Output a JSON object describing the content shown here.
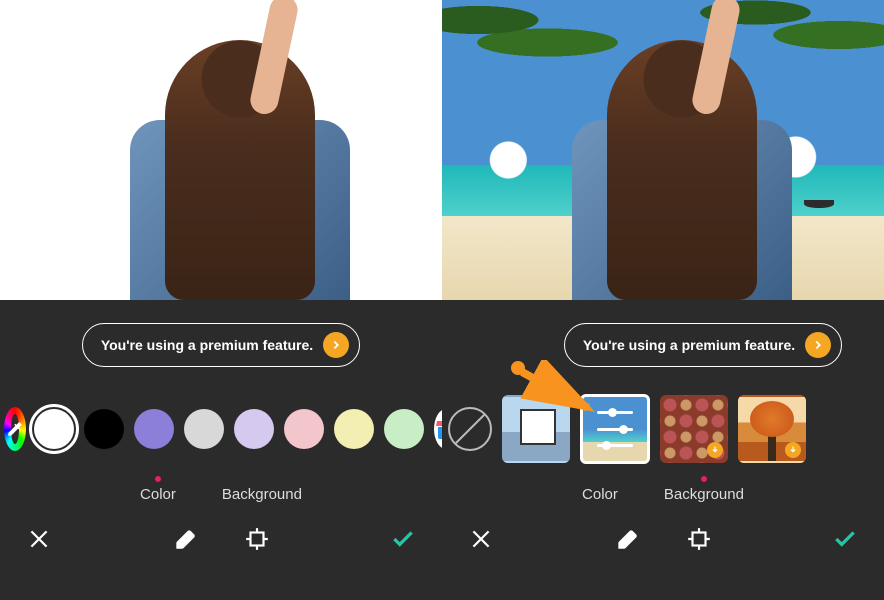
{
  "premium_banner": {
    "text": "You're using a premium feature."
  },
  "tabs": {
    "color": "Color",
    "background": "Background"
  },
  "left_panel": {
    "active_tab": "color",
    "swatches": [
      {
        "id": "white",
        "hex": "#ffffff",
        "selected": true
      },
      {
        "id": "black",
        "hex": "#000000"
      },
      {
        "id": "violet",
        "hex": "#8b7fd9"
      },
      {
        "id": "light-gray",
        "hex": "#d8d8d8"
      },
      {
        "id": "lavender",
        "hex": "#d6c9ef"
      },
      {
        "id": "pink",
        "hex": "#f3c6cb"
      },
      {
        "id": "cream",
        "hex": "#f3eeb2"
      },
      {
        "id": "mint",
        "hex": "#c9eec6"
      }
    ]
  },
  "right_panel": {
    "active_tab": "background",
    "thumbs": [
      {
        "id": "none",
        "kind": "none"
      },
      {
        "id": "gallery",
        "kind": "gallery"
      },
      {
        "id": "adjust-beach",
        "kind": "adjust",
        "selected": true
      },
      {
        "id": "pattern-floral",
        "kind": "pattern",
        "downloadable": true
      },
      {
        "id": "autumn",
        "kind": "scene",
        "downloadable": true
      }
    ]
  },
  "icons": {
    "eyedropper": "eyedropper-icon",
    "shop": "shop-icon",
    "none": "none-icon",
    "close": "close-icon",
    "eraser": "eraser-icon",
    "crop": "crop-icon",
    "check": "check-icon",
    "chevron": "chevron-right-icon",
    "download": "download-icon",
    "arrow": "pointer-arrow"
  }
}
